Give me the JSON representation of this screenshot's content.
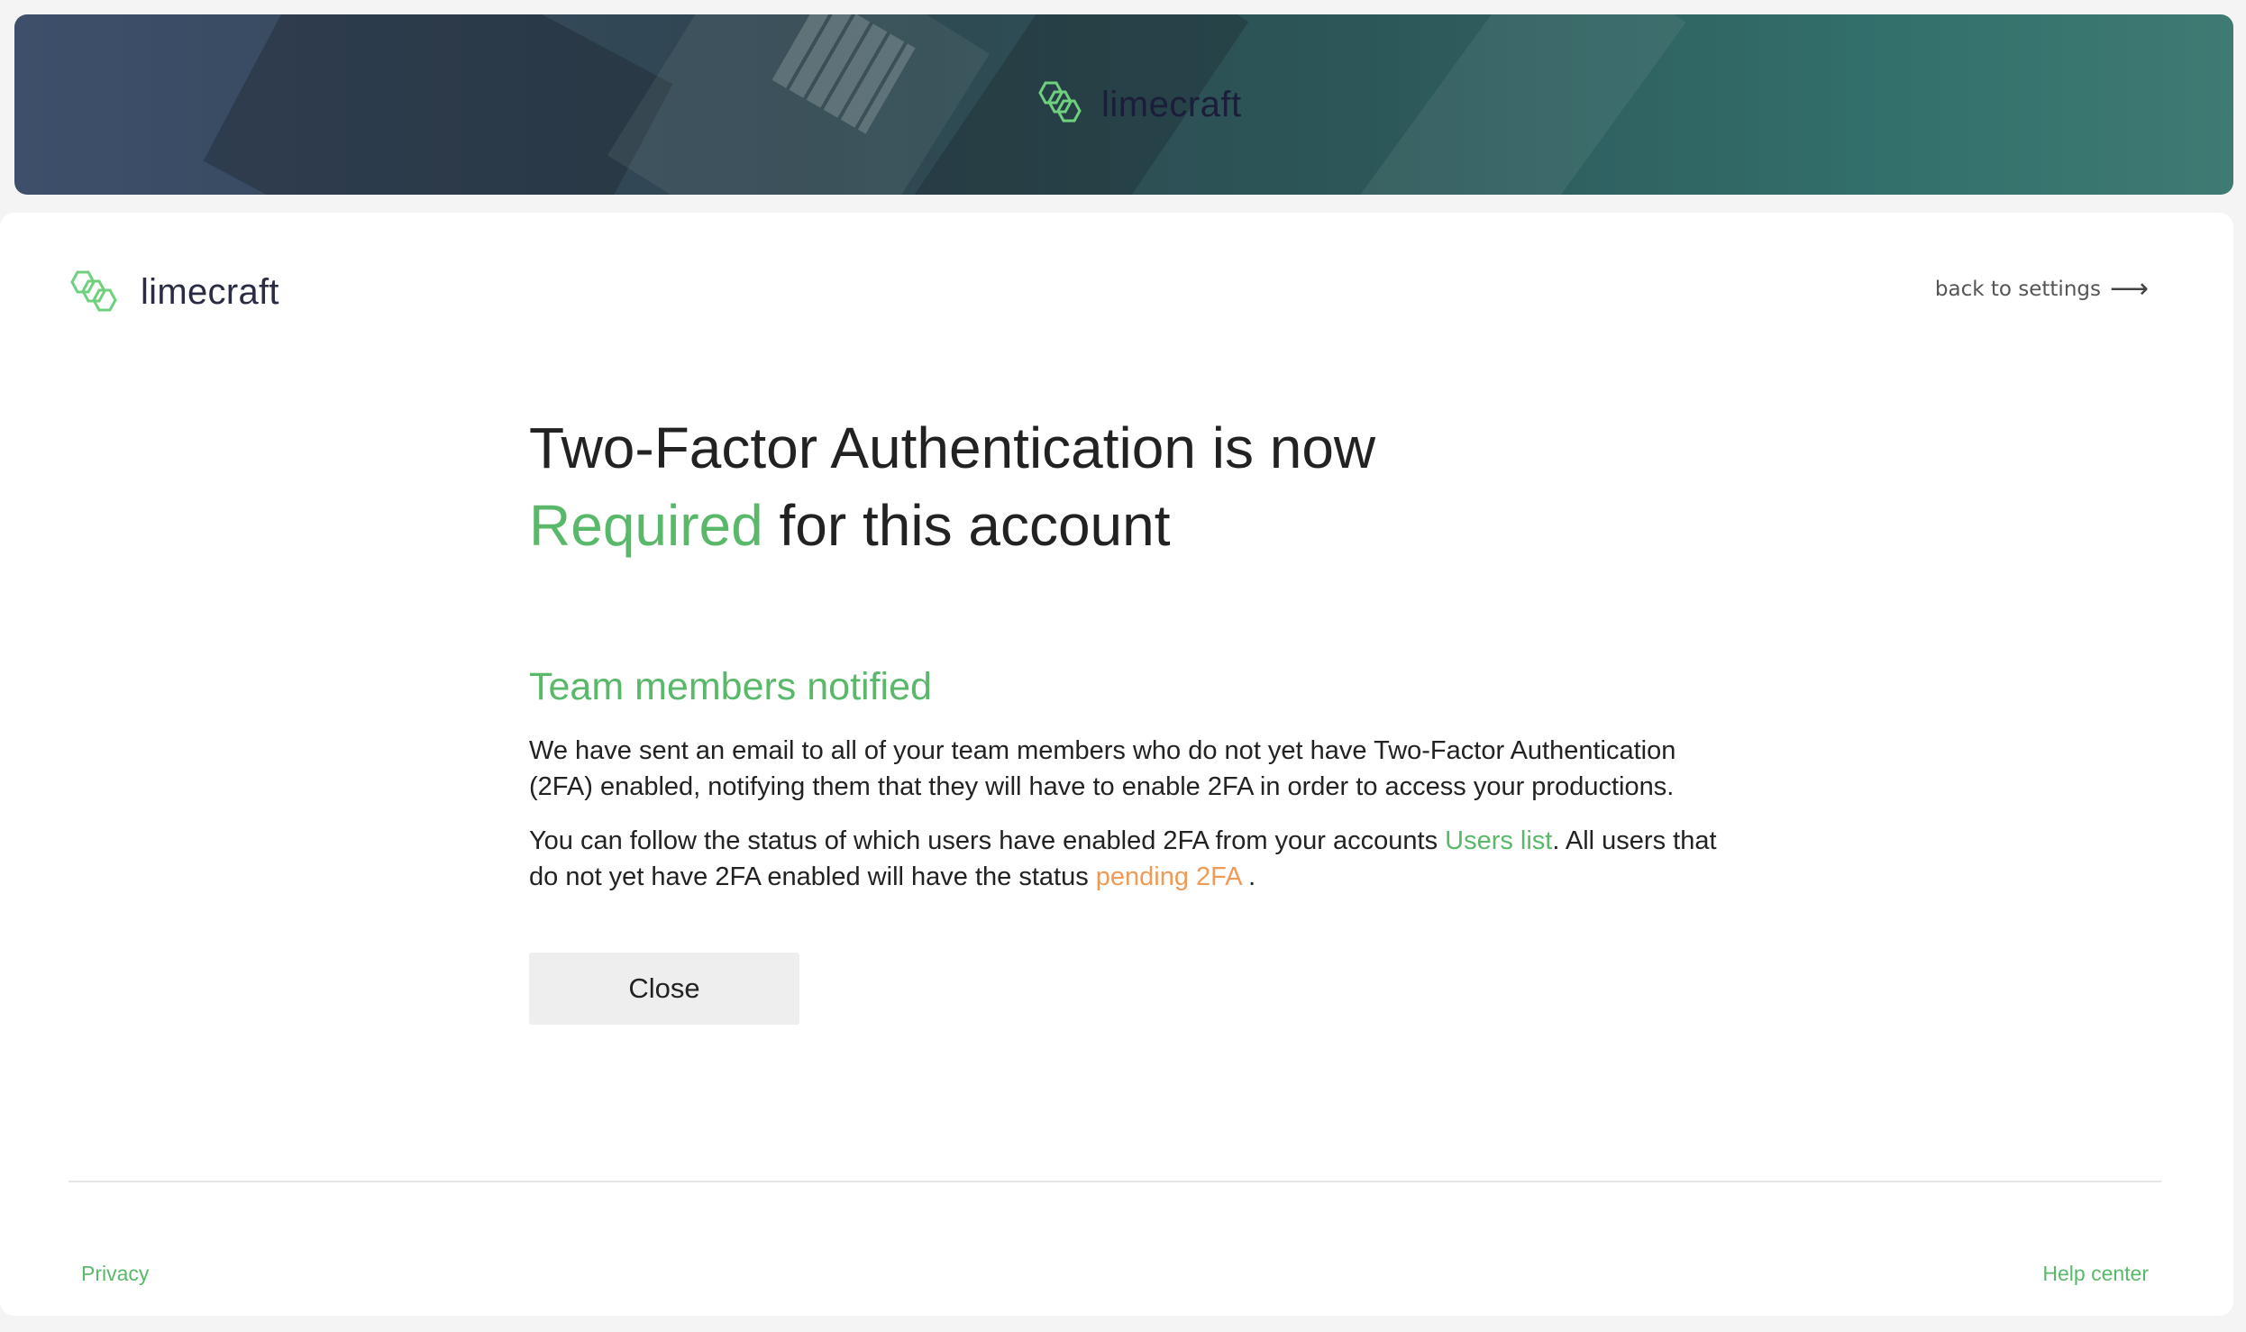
{
  "banner": {
    "logo_text": "limecraft"
  },
  "header": {
    "logo_text": "limecraft",
    "back_label": "back to settings"
  },
  "main": {
    "title_line1": "Two-Factor Authentication is now",
    "title_accent": "Required",
    "title_rest": " for this account",
    "subtitle": "Team members notified",
    "paragraph1": "We have sent an email to all of your team members who do not yet have Two-Factor Authentication (2FA) enabled, notifying them that they will have to enable 2FA in order to access your productions.",
    "paragraph2_before": "You can follow the status of which users have enabled 2FA from your accounts ",
    "paragraph2_link": "Users list",
    "paragraph2_middle": ". All users that do not yet have 2FA enabled will have the status ",
    "paragraph2_status": "pending 2FA",
    "paragraph2_end": " .",
    "close_label": "Close"
  },
  "footer": {
    "privacy_label": "Privacy",
    "help_label": "Help center"
  },
  "colors": {
    "accent_green": "#5ab86a",
    "status_orange": "#ef9a55",
    "logo_dark": "#1c1d3a"
  },
  "icons": {
    "logo_mark": "hexagon-logo-icon",
    "back_arrow": "arrow-right-icon"
  }
}
